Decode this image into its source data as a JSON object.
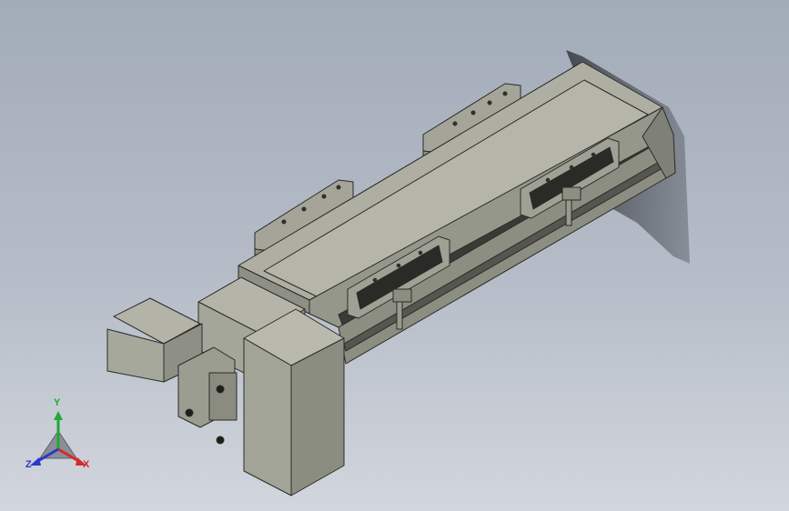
{
  "viewport": {
    "background_top": "#a2abb8",
    "background_bottom": "#d2d6dd",
    "part_color": "#a9aa9e",
    "edge_color": "#2b2b28",
    "dark_color": "#1e1e1c"
  },
  "triad": {
    "x_label": "X",
    "y_label": "Y",
    "z_label": "Z",
    "x_color": "#d42a2a",
    "y_color": "#22a834",
    "z_color": "#2a39cc"
  }
}
